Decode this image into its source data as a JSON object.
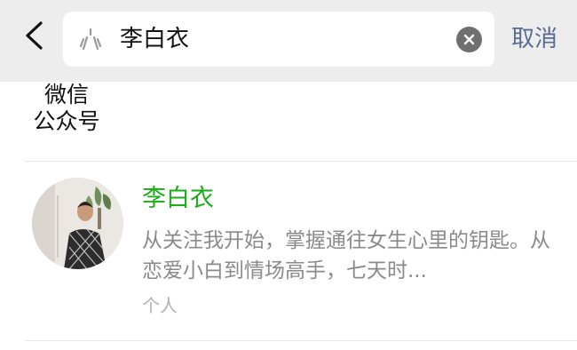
{
  "search": {
    "query": "李白衣",
    "cancel_label": "取消"
  },
  "section": {
    "title_line1": "微信",
    "title_line2": "公众号"
  },
  "result": {
    "name": "李白衣",
    "description": "从关注我开始，掌握通往女生心里的钥匙。从恋爱小白到情场高手，七天时...",
    "type": "个人"
  },
  "colors": {
    "accent_green": "#1aad19",
    "link_blue": "#576b95",
    "top_bar_bg": "#ededed"
  }
}
